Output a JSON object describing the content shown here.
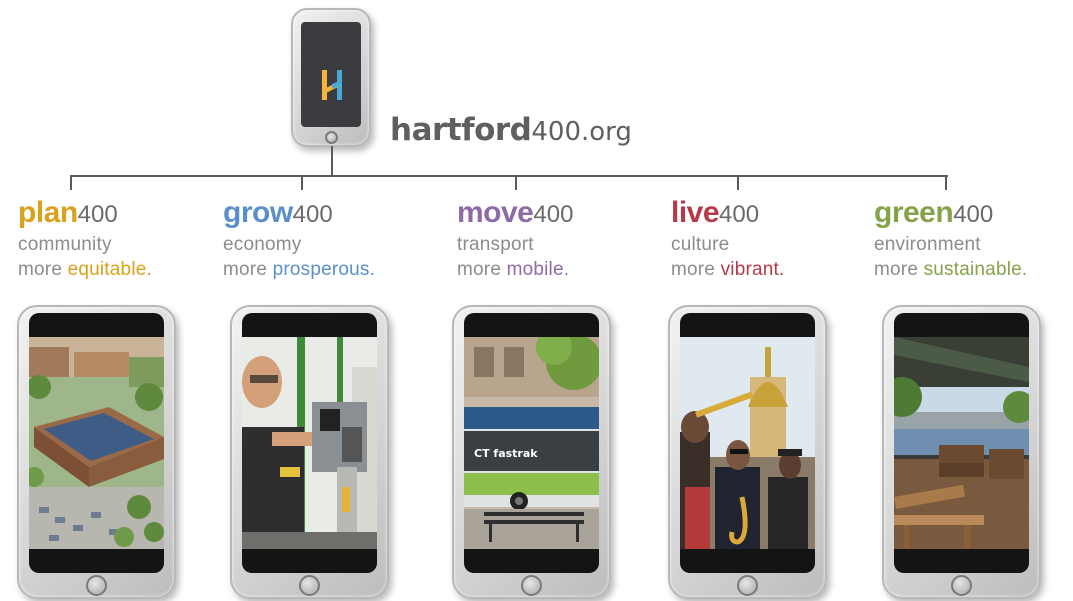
{
  "site": {
    "name_bold": "hartford",
    "name_suffix": "400.org",
    "logo_letter": "H"
  },
  "columns": [
    {
      "word": "plan",
      "number": "400",
      "category": "community",
      "more": "more",
      "adjective": "equitable.",
      "color": "#d9a21b",
      "image": "city-aerial-illustration"
    },
    {
      "word": "grow",
      "number": "400",
      "category": "economy",
      "more": "more",
      "adjective": "prosperous.",
      "color": "#5b8fc9",
      "image": "factory-worker-photo"
    },
    {
      "word": "move",
      "number": "400",
      "category": "transport",
      "more": "more",
      "adjective": "mobile.",
      "color": "#8e6aa8",
      "image": "ctfastrak-bus-photo"
    },
    {
      "word": "live",
      "number": "400",
      "category": "culture",
      "more": "more",
      "adjective": "vibrant.",
      "color": "#b53a48",
      "image": "street-musicians-capitol-photo"
    },
    {
      "word": "green",
      "number": "400",
      "category": "environment",
      "more": "more",
      "adjective": "sustainable.",
      "color": "#86a24a",
      "image": "riverfront-deck-photo"
    }
  ],
  "scene_text": {
    "bus_sign": "CT fastrak"
  },
  "colors": {
    "line": "#5a5a5a",
    "gray_text": "#8c8c8c",
    "title": "#5f5f61",
    "logo_yellow": "#f5b43a",
    "logo_blue": "#4aa8d8"
  }
}
